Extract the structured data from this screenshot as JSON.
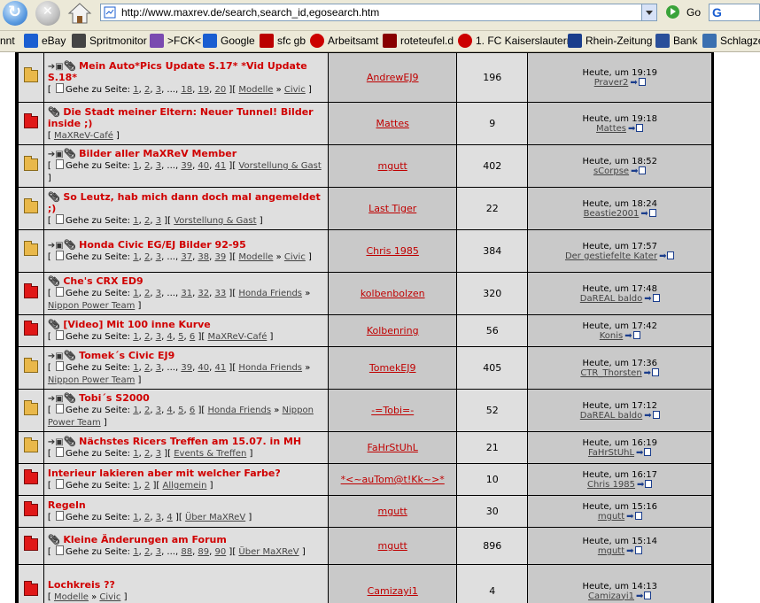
{
  "browser": {
    "address_url": "http://www.maxrev.de/search,search_id,egosearch.htm",
    "go_label": "Go",
    "search_logo": "G"
  },
  "links": [
    "nnt",
    "eBay",
    "Spritmonitor",
    ">FCK<",
    "Google",
    "sfc gb",
    "Arbeitsamt",
    "roteteufel.d",
    "1. FC Kaiserslautern",
    "Rhein-Zeitung",
    "Bank",
    "Schlagzei"
  ],
  "goto_label": "Gehe zu Seite:",
  "topics": [
    {
      "status": "normal",
      "flags": "➔▣",
      "attach": true,
      "title": "Mein Auto*Pics Update S.17* *Vid Update S.18*",
      "pages": [
        "1",
        "2",
        "3",
        "...",
        "18",
        "19",
        "20"
      ],
      "crumbs": [
        "Modelle",
        "Civic"
      ],
      "author": "AndrewEJ9",
      "replies": "196",
      "last_time": "Heute, um 19:19",
      "last_user": "Praver2"
    },
    {
      "status": "hot",
      "flags": "",
      "attach": true,
      "title": "Die Stadt meiner Eltern: Neuer Tunnel! Bilder inside ;)",
      "pages": [],
      "crumbs": [
        "MaXReV-Café"
      ],
      "author": "Mattes",
      "replies": "9",
      "last_time": "Heute, um 19:18",
      "last_user": "Mattes"
    },
    {
      "status": "normal",
      "flags": "➔▣",
      "attach": true,
      "title": "Bilder aller MaXReV Member",
      "pages": [
        "1",
        "2",
        "3",
        "...",
        "39",
        "40",
        "41"
      ],
      "crumbs": [
        "Vorstellung & Gast"
      ],
      "author": "mgutt",
      "replies": "402",
      "last_time": "Heute, um 18:52",
      "last_user": "sCorpse"
    },
    {
      "status": "normal",
      "flags": "",
      "attach": true,
      "title": "So Leutz, hab mich dann doch mal angemeldet ;)",
      "pages": [
        "1",
        "2",
        "3"
      ],
      "crumbs": [
        "Vorstellung & Gast"
      ],
      "author": "Last Tiger",
      "replies": "22",
      "last_time": "Heute, um 18:24",
      "last_user": "Beastie2001"
    },
    {
      "status": "normal",
      "flags": "➔▣",
      "attach": true,
      "title": "Honda Civic EG/EJ Bilder 92-95",
      "pages": [
        "1",
        "2",
        "3",
        "...",
        "37",
        "38",
        "39"
      ],
      "crumbs": [
        "Modelle",
        "Civic"
      ],
      "author": "Chris 1985",
      "replies": "384",
      "last_time": "Heute, um 17:57",
      "last_user": "Der gestiefelte Kater"
    },
    {
      "status": "hot",
      "flags": "",
      "attach": true,
      "title": "Che's CRX ED9",
      "pages": [
        "1",
        "2",
        "3",
        "...",
        "31",
        "32",
        "33"
      ],
      "crumbs": [
        "Honda Friends",
        "Nippon Power Team"
      ],
      "author": "kolbenbolzen",
      "replies": "320",
      "last_time": "Heute, um 17:48",
      "last_user": "DaREAL baldo"
    },
    {
      "status": "hot",
      "flags": "",
      "attach": true,
      "title": "[Video] Mit 100 inne Kurve",
      "pages": [
        "1",
        "2",
        "3",
        "4",
        "5",
        "6"
      ],
      "crumbs": [
        "MaXReV-Café"
      ],
      "author": "Kolbenring",
      "replies": "56",
      "last_time": "Heute, um 17:42",
      "last_user": "Konis"
    },
    {
      "status": "normal",
      "flags": "➔▣",
      "attach": true,
      "title": "Tomek´s Civic EJ9",
      "pages": [
        "1",
        "2",
        "3",
        "...",
        "39",
        "40",
        "41"
      ],
      "crumbs": [
        "Honda Friends",
        "Nippon Power Team"
      ],
      "author": "TomekEJ9",
      "replies": "405",
      "last_time": "Heute, um 17:36",
      "last_user": "CTR_Thorsten"
    },
    {
      "status": "normal",
      "flags": "➔▣",
      "attach": true,
      "title": "Tobi´s S2000",
      "pages": [
        "1",
        "2",
        "3",
        "4",
        "5",
        "6"
      ],
      "crumbs": [
        "Honda Friends",
        "Nippon Power Team"
      ],
      "author": "-=Tobi=-",
      "replies": "52",
      "last_time": "Heute, um 17:12",
      "last_user": "DaREAL baldo"
    },
    {
      "status": "normal",
      "flags": "➔▣",
      "attach": true,
      "title": "Nächstes Ricers Treffen am 15.07. in MH",
      "pages": [
        "1",
        "2",
        "3"
      ],
      "crumbs": [
        "Events & Treffen"
      ],
      "author": "FaHrStUhL",
      "replies": "21",
      "last_time": "Heute, um 16:19",
      "last_user": "FaHrStUhL"
    },
    {
      "status": "hot",
      "flags": "",
      "attach": false,
      "title": "Interieur lakieren aber mit welcher Farbe?",
      "pages": [
        "1",
        "2"
      ],
      "crumbs": [
        "Allgemein"
      ],
      "author": "*<~auTom@t!Kk~>*",
      "replies": "10",
      "last_time": "Heute, um 16:17",
      "last_user": "Chris 1985"
    },
    {
      "status": "hot",
      "flags": "",
      "attach": false,
      "title": "Regeln",
      "pages": [
        "1",
        "2",
        "3",
        "4"
      ],
      "crumbs": [
        "Über MaXReV"
      ],
      "author": "mgutt",
      "replies": "30",
      "last_time": "Heute, um 15:16",
      "last_user": "mgutt"
    },
    {
      "status": "hot",
      "flags": "",
      "attach": true,
      "title": "Kleine Änderungen am Forum",
      "pages": [
        "1",
        "2",
        "3",
        "...",
        "88",
        "89",
        "90"
      ],
      "crumbs": [
        "Über MaXReV"
      ],
      "author": "mgutt",
      "replies": "896",
      "last_time": "Heute, um 15:14",
      "last_user": "mgutt"
    },
    {
      "status": "hot",
      "flags": "",
      "attach": false,
      "title": "Lochkreis ??",
      "pages": [],
      "crumbs": [
        "Modelle",
        "Civic"
      ],
      "author": "Camizayi1",
      "replies": "4",
      "last_time": "Heute, um 14:13",
      "last_user": "Camizayi1"
    }
  ],
  "colors": {
    "title_red": "#d00000",
    "author_red": "#c00000",
    "row_light": "#dfdfdf",
    "row_dark": "#c9c9c9",
    "hot_folder": "#e01818",
    "normal_folder": "#e9b84a"
  }
}
